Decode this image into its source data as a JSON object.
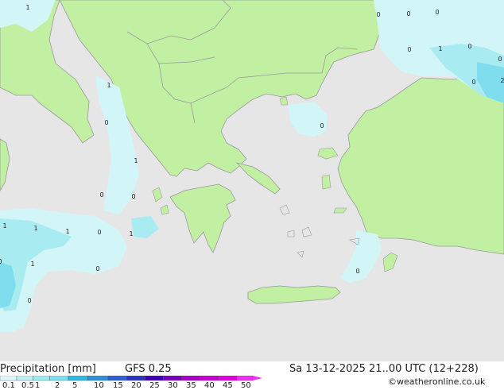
{
  "title": "Precipitation [mm]",
  "model": "GFS 0.25",
  "valid_time": "Sa 13-12-2025 21..00 UTC (12+228)",
  "credit": "©weatheronline.co.uk",
  "legend": {
    "ticks": [
      "0.1",
      "0.5",
      "1",
      "2",
      "5",
      "10",
      "15",
      "20",
      "25",
      "30",
      "35",
      "40",
      "45",
      "50"
    ],
    "colors": [
      "#e0f8fa",
      "#bff1f6",
      "#9fe9f1",
      "#7fdded",
      "#2fb8e0",
      "#2f8fd8",
      "#2f60d0",
      "#2e34c2",
      "#3a00b4",
      "#7a00c0",
      "#a800c8",
      "#c800d0",
      "#e000e0",
      "#f030f0"
    ]
  },
  "colors": {
    "sea": "#e6e6e6",
    "land": "#c2f0a2",
    "precip_light": "#d2f6f8",
    "precip_medium": "#a8ecf2",
    "precip_heavy": "#7fdded",
    "border": "#9a9a9a"
  },
  "value_labels": [
    "1",
    "1",
    "1",
    "0",
    "0",
    "1",
    "1",
    "0",
    "1",
    "1",
    "0",
    "0",
    "1",
    "0",
    "0",
    "0",
    "0",
    "0",
    "0",
    "0",
    "0",
    "1",
    "0",
    "0",
    "2",
    "0",
    "0",
    "0"
  ]
}
